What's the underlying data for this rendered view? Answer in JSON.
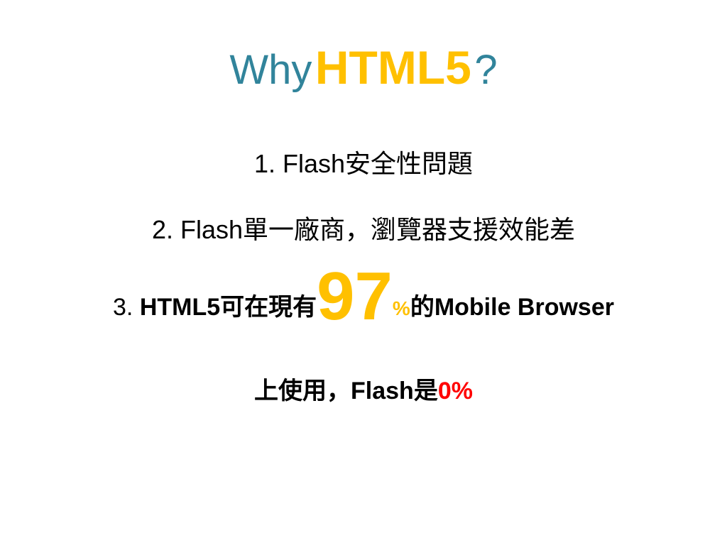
{
  "slide": {
    "title": {
      "prefix": "Why",
      "highlight": "HTML5",
      "suffix": "?"
    },
    "points": {
      "p1": "1. Flash安全性問題",
      "p2": "2. Flash單一廠商，瀏覽器支援效能差",
      "p3": {
        "number_prefix": "3. ",
        "lead": "HTML5可在現有",
        "big_number": "97",
        "percent": "%",
        "tail": "的Mobile Browser"
      },
      "p4": {
        "lead": "上使用，Flash是",
        "value": "0%"
      }
    }
  },
  "colors": {
    "title_teal": "#31849B",
    "highlight_gold": "#FFC000",
    "alert_red": "#FF0000",
    "text": "#000000",
    "background": "#FFFFFF"
  }
}
